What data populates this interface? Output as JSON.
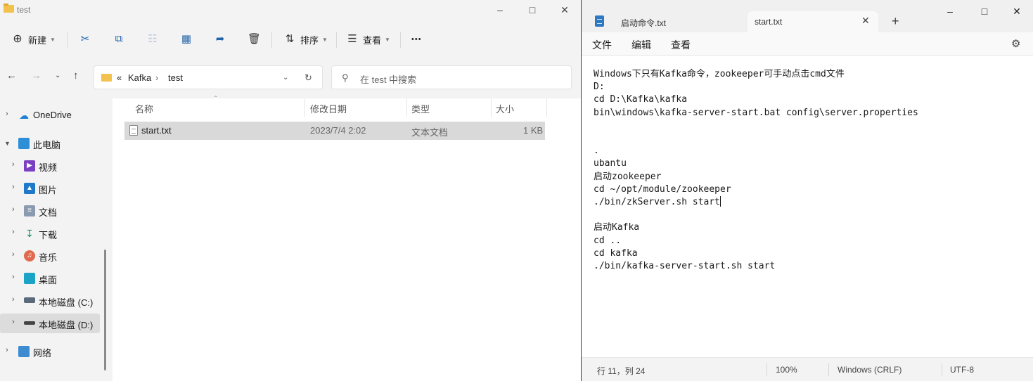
{
  "explorer": {
    "window_title": "test",
    "toolbar": {
      "new_label": "新建",
      "sort_label": "排序",
      "view_label": "查看",
      "more_label": "•••"
    },
    "address": {
      "overflow": "«",
      "crumbs": [
        "Kafka",
        "test"
      ],
      "separator": "›"
    },
    "search": {
      "placeholder": "在 test 中搜索"
    },
    "nav": [
      {
        "label": "OneDrive",
        "icon": "cloud-icon"
      },
      {
        "label": "此电脑",
        "icon": "computer-icon"
      },
      {
        "label": "视频",
        "icon": "video-icon"
      },
      {
        "label": "图片",
        "icon": "picture-icon"
      },
      {
        "label": "文档",
        "icon": "document-icon"
      },
      {
        "label": "下载",
        "icon": "download-icon"
      },
      {
        "label": "音乐",
        "icon": "music-icon"
      },
      {
        "label": "桌面",
        "icon": "desktop-icon"
      },
      {
        "label": "本地磁盘 (C:)",
        "icon": "drive-icon"
      },
      {
        "label": "本地磁盘 (D:)",
        "icon": "drive-icon",
        "selected": true
      },
      {
        "label": "网络",
        "icon": "network-icon"
      }
    ],
    "columns": [
      "名称",
      "修改日期",
      "类型",
      "大小"
    ],
    "files": [
      {
        "name": "start.txt",
        "modified": "2023/7/4 2:02",
        "type": "文本文档",
        "size": "1 KB"
      }
    ]
  },
  "notepad": {
    "tabs": [
      {
        "label": "启动命令.txt",
        "active": false
      },
      {
        "label": "start.txt",
        "active": true
      }
    ],
    "menu": [
      "文件",
      "编辑",
      "查看"
    ],
    "lines": [
      "Windows下只有Kafka命令，zookeeper可手动点击cmd文件",
      "D:",
      "cd D:\\Kafka\\kafka",
      "bin\\windows\\kafka-server-start.bat config\\server.properties",
      "",
      "",
      ".",
      "ubantu",
      "启动zookeeper",
      "cd ~/opt/module/zookeeper",
      "./bin/zkServer.sh start",
      "",
      "启动Kafka",
      "cd ..",
      "cd kafka",
      "./bin/kafka-server-start.sh start"
    ],
    "status": {
      "position": "行 11，列 24",
      "zoom": "100%",
      "line_ending": "Windows (CRLF)",
      "encoding": "UTF-8"
    }
  },
  "colors": {
    "explorer_bg": "#f3f3f3",
    "selection": "#d9d9d9",
    "accent": "#2264a8"
  }
}
